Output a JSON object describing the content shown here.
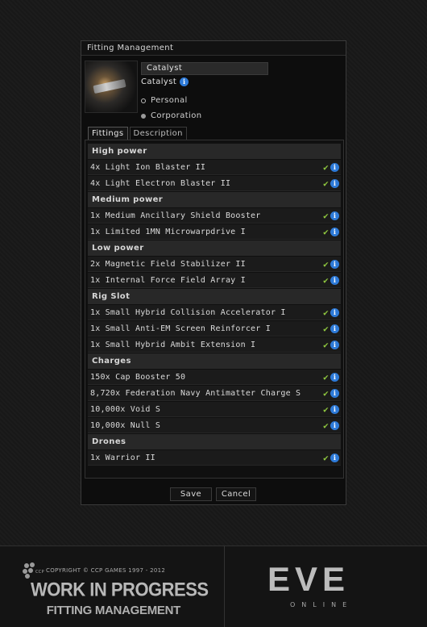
{
  "window": {
    "title": "Fitting Management"
  },
  "fitting": {
    "name_value": "Catalyst",
    "ship_type": "Catalyst",
    "owner_options": [
      {
        "label": "Personal",
        "selected": false
      },
      {
        "label": "Corporation",
        "selected": true
      }
    ]
  },
  "tabs": [
    {
      "label": "Fittings",
      "active": true
    },
    {
      "label": "Description",
      "active": false
    }
  ],
  "sections": [
    {
      "title": "High power",
      "items": [
        "4x Light Ion Blaster II",
        "4x Light Electron Blaster II"
      ]
    },
    {
      "title": "Medium power",
      "items": [
        "1x Medium Ancillary Shield Booster",
        "1x Limited 1MN Microwarpdrive I"
      ]
    },
    {
      "title": "Low power",
      "items": [
        "2x Magnetic Field Stabilizer II",
        "1x Internal Force Field Array I"
      ]
    },
    {
      "title": "Rig Slot",
      "items": [
        "1x Small Hybrid Collision Accelerator I",
        "1x Small Anti-EM Screen Reinforcer I",
        "1x Small Hybrid Ambit Extension I"
      ]
    },
    {
      "title": "Charges",
      "items": [
        "150x Cap Booster 50",
        "8,720x Federation Navy Antimatter Charge S",
        "10,000x Void S",
        "10,000x Null S"
      ]
    },
    {
      "title": "Drones",
      "items": [
        "1x Warrior II"
      ]
    }
  ],
  "buttons": {
    "save": "Save",
    "cancel": "Cancel"
  },
  "footer": {
    "copyright": "COPYRIGHT © CCP GAMES 1997 - 2012",
    "ccp_logo_text": "CCP",
    "wip_title": "WORK IN PROGRESS",
    "wip_subtitle": "FITTING MANAGEMENT",
    "eve_logo": "EVE",
    "eve_online": "ONLINE"
  },
  "colors": {
    "check": "#8ec63f",
    "info": "#2d7ad8",
    "section_bg": "#282828"
  }
}
